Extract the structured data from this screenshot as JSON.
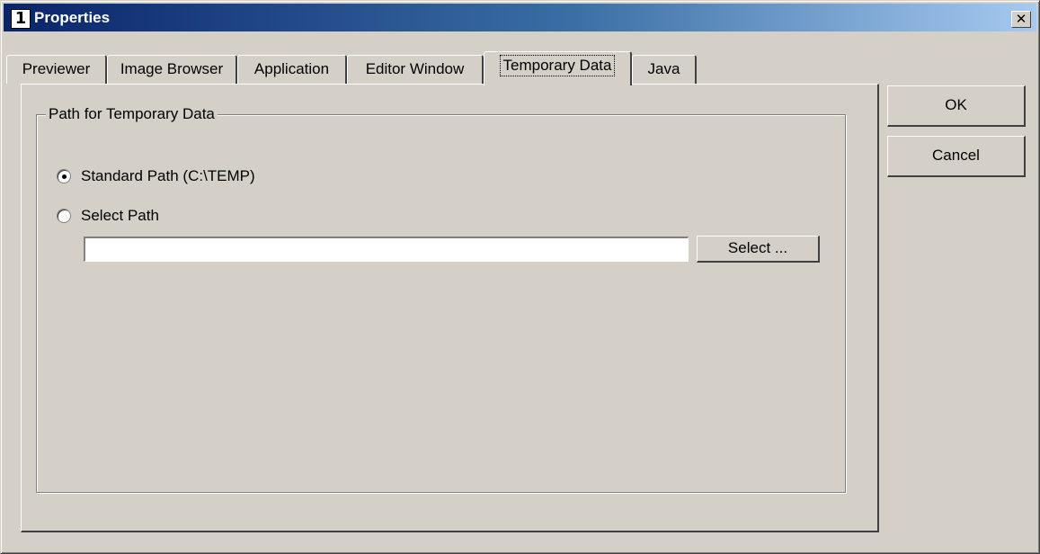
{
  "window": {
    "icon_glyph": "1",
    "title": "Properties",
    "close_glyph": "✕"
  },
  "tabs": [
    {
      "label": "Previewer",
      "active": false
    },
    {
      "label": "Image Browser",
      "active": false
    },
    {
      "label": "Application",
      "active": false
    },
    {
      "label": "Editor Window",
      "active": false
    },
    {
      "label": "Temporary Data",
      "active": true
    },
    {
      "label": "Java",
      "active": false
    }
  ],
  "group": {
    "legend": "Path for Temporary Data",
    "options": [
      {
        "label": "Standard Path (C:\\TEMP)",
        "selected": true
      },
      {
        "label": "Select Path",
        "selected": false
      }
    ],
    "path_value": "",
    "select_button": "Select ..."
  },
  "buttons": {
    "ok": "OK",
    "cancel": "Cancel"
  }
}
